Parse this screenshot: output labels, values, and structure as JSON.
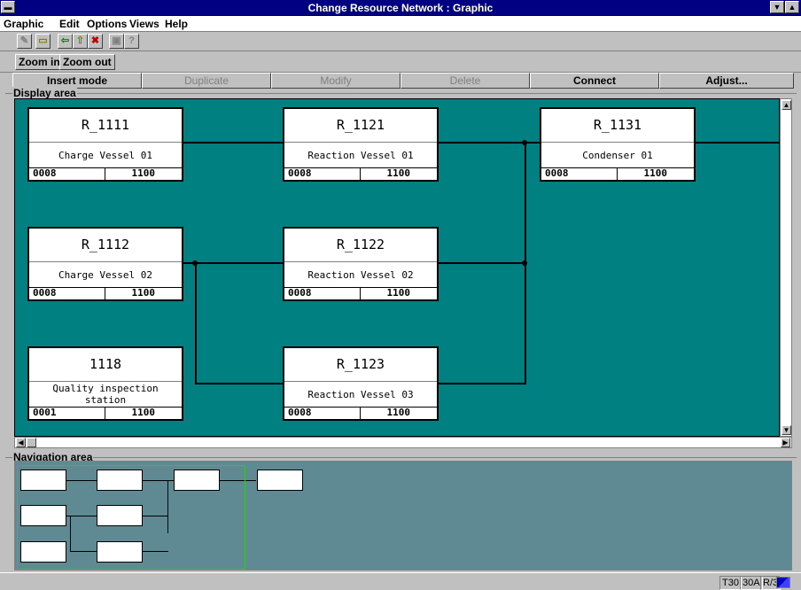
{
  "window": {
    "title": "Change Resource Network : Graphic"
  },
  "menu": [
    "Graphic",
    "Edit",
    "Options",
    "Views",
    "Help"
  ],
  "toolbar": {
    "icons": [
      "pencil-icon",
      "open-folder-icon",
      "back-arrow-icon",
      "up-arrow-icon",
      "delete-x-icon",
      "zoom-page-icon",
      "help-icon"
    ]
  },
  "zoom": {
    "zoom_in": "Zoom in",
    "zoom_out": "Zoom out"
  },
  "actions": [
    {
      "label": "Insert mode",
      "enabled": true
    },
    {
      "label": "Duplicate",
      "enabled": false
    },
    {
      "label": "Modify",
      "enabled": false
    },
    {
      "label": "Delete",
      "enabled": false
    },
    {
      "label": "Connect",
      "enabled": true
    },
    {
      "label": "Adjust...",
      "enabled": true
    }
  ],
  "display": {
    "label": "Display area",
    "nodes": [
      {
        "id": "R_1111",
        "desc": "Charge Vessel 01",
        "v1": "0008",
        "v2": "1100"
      },
      {
        "id": "R_1121",
        "desc": "Reaction Vessel 01",
        "v1": "0008",
        "v2": "1100"
      },
      {
        "id": "R_1131",
        "desc": "Condenser 01",
        "v1": "0008",
        "v2": "1100"
      },
      {
        "id": "R_1112",
        "desc": "Charge Vessel 02",
        "v1": "0008",
        "v2": "1100"
      },
      {
        "id": "R_1122",
        "desc": "Reaction Vessel 02",
        "v1": "0008",
        "v2": "1100"
      },
      {
        "id": "1118",
        "desc": "Quality inspection\nstation",
        "v1": "0001",
        "v2": "1100"
      },
      {
        "id": "R_1123",
        "desc": "Reaction Vessel 03",
        "v1": "0008",
        "v2": "1100"
      }
    ]
  },
  "navigation": {
    "label": "Navigation area"
  },
  "status": [
    "T30",
    "30A",
    "R/3"
  ],
  "colors": {
    "canvas": "#008080",
    "navigation": "#5f8a94",
    "titlebar": "#000080",
    "viewport": "#3cbe3c"
  }
}
